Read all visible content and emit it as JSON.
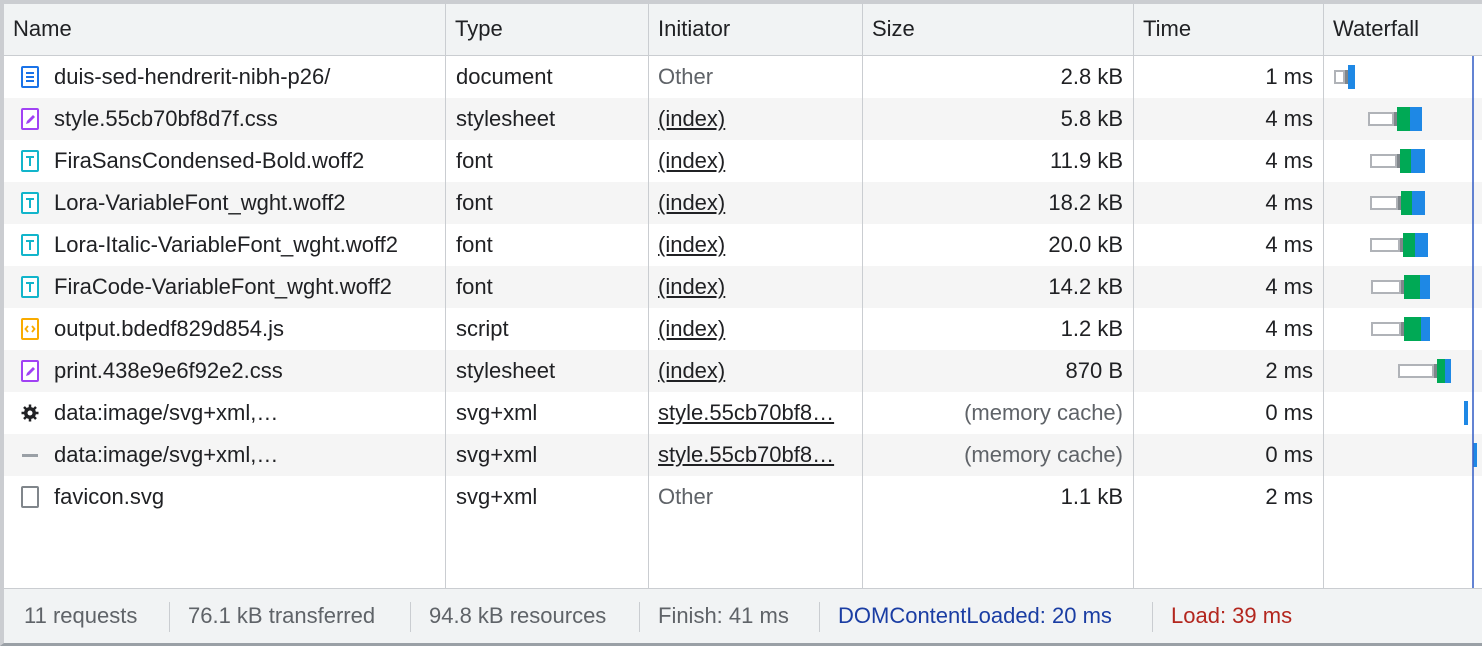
{
  "columns": {
    "name": "Name",
    "type": "Type",
    "initiator": "Initiator",
    "size": "Size",
    "time": "Time",
    "waterfall": "Waterfall"
  },
  "colors": {
    "document": "#1a73e8",
    "stylesheet": "#a142f4",
    "font": "#12b5cb",
    "script": "#f9ab00",
    "wf_wait_border": "#b0b3b8",
    "wf_waiting": "#00a955",
    "wf_download": "#1e88e5",
    "dcl": "#1a3da3",
    "load": "#b3261e"
  },
  "rows": [
    {
      "name": "duis-sed-hendrerit-nibh-p26/",
      "type": "document",
      "initiator": "Other",
      "initiator_link": false,
      "size": "2.8 kB",
      "size_gray": false,
      "time": "1 ms",
      "icon": "document-icon"
    },
    {
      "name": "style.55cb70bf8d7f.css",
      "type": "stylesheet",
      "initiator": "(index)",
      "initiator_link": true,
      "size": "5.8 kB",
      "size_gray": false,
      "time": "4 ms",
      "icon": "stylesheet-icon"
    },
    {
      "name": "FiraSansCondensed-Bold.woff2",
      "type": "font",
      "initiator": "(index)",
      "initiator_link": true,
      "size": "11.9 kB",
      "size_gray": false,
      "time": "4 ms",
      "icon": "font-icon"
    },
    {
      "name": "Lora-VariableFont_wght.woff2",
      "type": "font",
      "initiator": "(index)",
      "initiator_link": true,
      "size": "18.2 kB",
      "size_gray": false,
      "time": "4 ms",
      "icon": "font-icon"
    },
    {
      "name": "Lora-Italic-VariableFont_wght.woff2",
      "type": "font",
      "initiator": "(index)",
      "initiator_link": true,
      "size": "20.0 kB",
      "size_gray": false,
      "time": "4 ms",
      "icon": "font-icon"
    },
    {
      "name": "FiraCode-VariableFont_wght.woff2",
      "type": "font",
      "initiator": "(index)",
      "initiator_link": true,
      "size": "14.2 kB",
      "size_gray": false,
      "time": "4 ms",
      "icon": "font-icon"
    },
    {
      "name": "output.bdedf829d854.js",
      "type": "script",
      "initiator": "(index)",
      "initiator_link": true,
      "size": "1.2 kB",
      "size_gray": false,
      "time": "4 ms",
      "icon": "script-icon"
    },
    {
      "name": "print.438e9e6f92e2.css",
      "type": "stylesheet",
      "initiator": "(index)",
      "initiator_link": true,
      "size": "870 B",
      "size_gray": false,
      "time": "2 ms",
      "icon": "stylesheet-icon"
    },
    {
      "name": "data:image/svg+xml,…",
      "type": "svg+xml",
      "initiator": "style.55cb70bf8…",
      "initiator_link": true,
      "size": "(memory cache)",
      "size_gray": true,
      "time": "0 ms",
      "icon": "gear-image-icon"
    },
    {
      "name": "data:image/svg+xml,…",
      "type": "svg+xml",
      "initiator": "style.55cb70bf8…",
      "initiator_link": true,
      "size": "(memory cache)",
      "size_gray": true,
      "time": "0 ms",
      "icon": "dash-image-icon"
    },
    {
      "name": "favicon.svg",
      "type": "svg+xml",
      "initiator": "Other",
      "initiator_link": false,
      "size": "1.1 kB",
      "size_gray": false,
      "time": "2 ms",
      "icon": "blank-file-icon"
    }
  ],
  "footer": {
    "requests": "11 requests",
    "transferred": "76.1 kB transferred",
    "resources": "94.8 kB resources",
    "finish": "Finish: 41 ms",
    "dom_content_loaded": "DOMContentLoaded: 20 ms",
    "load": "Load: 39 ms"
  }
}
